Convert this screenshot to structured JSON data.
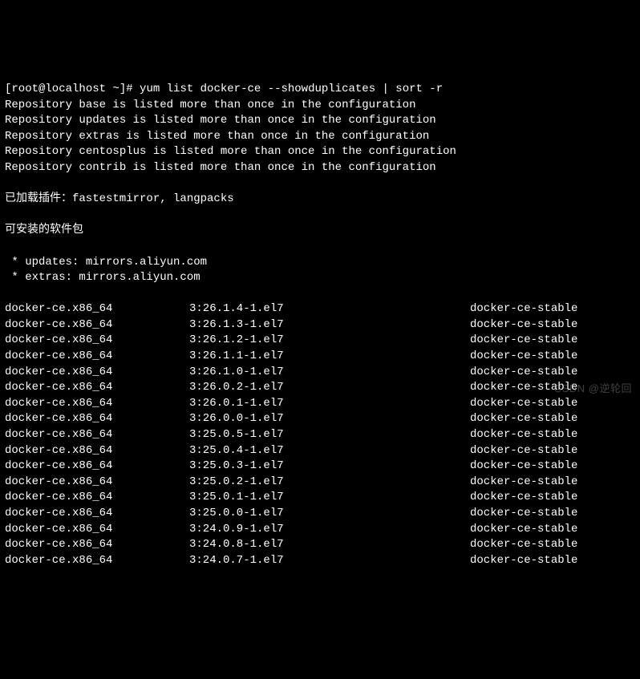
{
  "prompt": {
    "user_host": "[root@localhost ~]#",
    "command": "yum list docker-ce --showduplicates | sort -r"
  },
  "warnings": [
    "Repository base is listed more than once in the configuration",
    "Repository updates is listed more than once in the configuration",
    "Repository extras is listed more than once in the configuration",
    "Repository centosplus is listed more than once in the configuration",
    "Repository contrib is listed more than once in the configuration"
  ],
  "plugins_line": "已加载插件：fastestmirror, langpacks",
  "available_line": "可安装的软件包",
  "mirrors": [
    " * updates: mirrors.aliyun.com",
    " * extras: mirrors.aliyun.com"
  ],
  "packages": [
    {
      "name": "docker-ce.x86_64",
      "version": "3:26.1.4-1.el7",
      "repo": "docker-ce-stable"
    },
    {
      "name": "docker-ce.x86_64",
      "version": "3:26.1.3-1.el7",
      "repo": "docker-ce-stable"
    },
    {
      "name": "docker-ce.x86_64",
      "version": "3:26.1.2-1.el7",
      "repo": "docker-ce-stable"
    },
    {
      "name": "docker-ce.x86_64",
      "version": "3:26.1.1-1.el7",
      "repo": "docker-ce-stable"
    },
    {
      "name": "docker-ce.x86_64",
      "version": "3:26.1.0-1.el7",
      "repo": "docker-ce-stable"
    },
    {
      "name": "docker-ce.x86_64",
      "version": "3:26.0.2-1.el7",
      "repo": "docker-ce-stable"
    },
    {
      "name": "docker-ce.x86_64",
      "version": "3:26.0.1-1.el7",
      "repo": "docker-ce-stable"
    },
    {
      "name": "docker-ce.x86_64",
      "version": "3:26.0.0-1.el7",
      "repo": "docker-ce-stable"
    },
    {
      "name": "docker-ce.x86_64",
      "version": "3:25.0.5-1.el7",
      "repo": "docker-ce-stable"
    },
    {
      "name": "docker-ce.x86_64",
      "version": "3:25.0.4-1.el7",
      "repo": "docker-ce-stable"
    },
    {
      "name": "docker-ce.x86_64",
      "version": "3:25.0.3-1.el7",
      "repo": "docker-ce-stable"
    },
    {
      "name": "docker-ce.x86_64",
      "version": "3:25.0.2-1.el7",
      "repo": "docker-ce-stable"
    },
    {
      "name": "docker-ce.x86_64",
      "version": "3:25.0.1-1.el7",
      "repo": "docker-ce-stable"
    },
    {
      "name": "docker-ce.x86_64",
      "version": "3:25.0.0-1.el7",
      "repo": "docker-ce-stable"
    },
    {
      "name": "docker-ce.x86_64",
      "version": "3:24.0.9-1.el7",
      "repo": "docker-ce-stable"
    },
    {
      "name": "docker-ce.x86_64",
      "version": "3:24.0.8-1.el7",
      "repo": "docker-ce-stable"
    },
    {
      "name": "docker-ce.x86_64",
      "version": "3:24.0.7-1.el7",
      "repo": "docker-ce-stable"
    }
  ],
  "watermark": "CSDN @逆轮回"
}
